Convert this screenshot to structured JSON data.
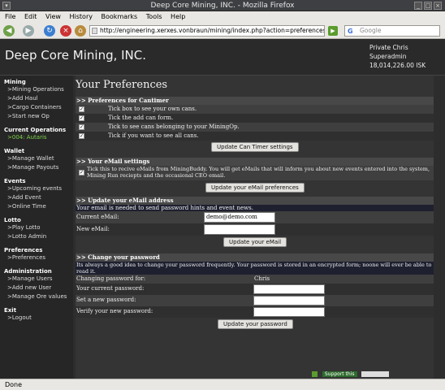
{
  "window": {
    "title": "Deep Core Mining, INC. - Mozilla Firefox"
  },
  "menubar": [
    "File",
    "Edit",
    "View",
    "History",
    "Bookmarks",
    "Tools",
    "Help"
  ],
  "navbar": {
    "url": "http://engineering.xerxes.vonbraun/mining/index.php?action=preferences",
    "search_placeholder": "Google"
  },
  "header": {
    "brand": "Deep Core Mining, INC.",
    "user_line1": "Private Chris",
    "user_line2": "Superadmin",
    "user_line3": "18,014,226.00 ISK"
  },
  "sidebar": {
    "mining": {
      "title": "Mining",
      "items": [
        ">Mining Operations",
        ">Add Haul",
        ">Cargo Containers",
        ">Start new Op"
      ]
    },
    "current": {
      "title": "Current Operations",
      "items": [
        ">004: Autaris"
      ]
    },
    "wallet": {
      "title": "Wallet",
      "items": [
        ">Manage Wallet",
        ">Manage Payouts"
      ]
    },
    "events": {
      "title": "Events",
      "items": [
        ">Upcoming events",
        ">Add Event",
        ">Online Time"
      ]
    },
    "lotto": {
      "title": "Lotto",
      "items": [
        ">Play Lotto",
        ">Lotto Admin"
      ]
    },
    "prefs": {
      "title": "Preferences",
      "items": [
        ">Preferences"
      ]
    },
    "admin": {
      "title": "Administration",
      "items": [
        ">Manage Users",
        ">Add new User",
        ">Manage Ore values"
      ]
    },
    "exit": {
      "title": "Exit",
      "items": [
        ">Logout"
      ]
    }
  },
  "main": {
    "title": "Your Preferences",
    "cantimer": {
      "heading": ">> Preferences for Cantimer",
      "options": [
        "Tick box to see your own cans.",
        "Tick the add can form.",
        "Tick to see cans belonging to your MiningOp.",
        "Tick if you want to see all cans."
      ],
      "button": "Update Can Timer settings"
    },
    "email": {
      "heading": ">> Your eMail settings",
      "text": "Tick this to recive eMails from MiningBuddy. You will get eMails that will inform you about new events entered into the system, Mining Run reciepts and the occasional CEO email.",
      "button": "Update your eMail preferences"
    },
    "address": {
      "heading": ">> Update your eMail address",
      "note": "Your email is needed to send password hints and event news.",
      "current_label": "Current eMail:",
      "current_value": "demo@demo.com",
      "new_label": "New eMail:",
      "button": "Update your eMail"
    },
    "password": {
      "heading": ">> Change your password",
      "note": "Its always a good idea to change your password frequently. Your password is stored in an encrypted form; noone will ever be able to read it.",
      "changing_label": "Changing password for:",
      "changing_value": "Chris",
      "current_label": "Your current password:",
      "new_label": "Set a new password:",
      "verify_label": "Verify your new password:",
      "button": "Update your password"
    }
  },
  "footer": {
    "support": "Support this"
  },
  "status": "Done"
}
